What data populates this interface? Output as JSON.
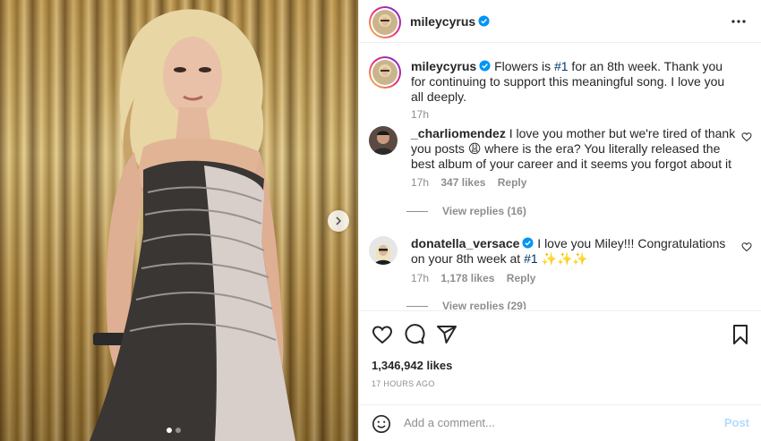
{
  "post": {
    "author": "mileycyrus",
    "caption": {
      "username": "mileycyrus",
      "text_before": "Flowers is ",
      "hashtag": "#1",
      "text_after": " for an 8th week. Thank you for continuing to support this meaningful song. I love you all deeply.",
      "time": "17h"
    },
    "media": {
      "carousel_slides": 2,
      "active_slide": 1
    }
  },
  "comments": [
    {
      "username": "_charliomendez",
      "text": "I love you mother but we're tired of thank you posts 😩 where is the era? You literally released the best album of your career and it seems you forgot about it",
      "time": "17h",
      "likes": "347 likes",
      "reply": "Reply",
      "view_replies": "View replies (16)"
    },
    {
      "username": "donatella_versace",
      "verified": true,
      "text_before": "I love you Miley!!! Congratulations on your 8th week at ",
      "hashtag": "#1",
      "text_after": " ✨✨✨",
      "time": "17h",
      "likes": "1,178 likes",
      "reply": "Reply",
      "view_replies": "View replies (29)"
    }
  ],
  "actions": {
    "likes": "1,346,942 likes",
    "time_ago": "17 HOURS AGO"
  },
  "comment_box": {
    "placeholder": "Add a comment...",
    "post_label": "Post"
  },
  "icons": {
    "verified": "verified-badge-icon",
    "more": "more-options-icon",
    "like": "heart-icon",
    "comment": "comment-icon",
    "share": "share-icon",
    "save": "bookmark-icon",
    "emoji": "emoji-icon",
    "next": "chevron-right-icon"
  },
  "colors": {
    "verified_blue": "#0095f6",
    "post_disabled": "#b3dbff",
    "hashtag": "#00376b"
  }
}
